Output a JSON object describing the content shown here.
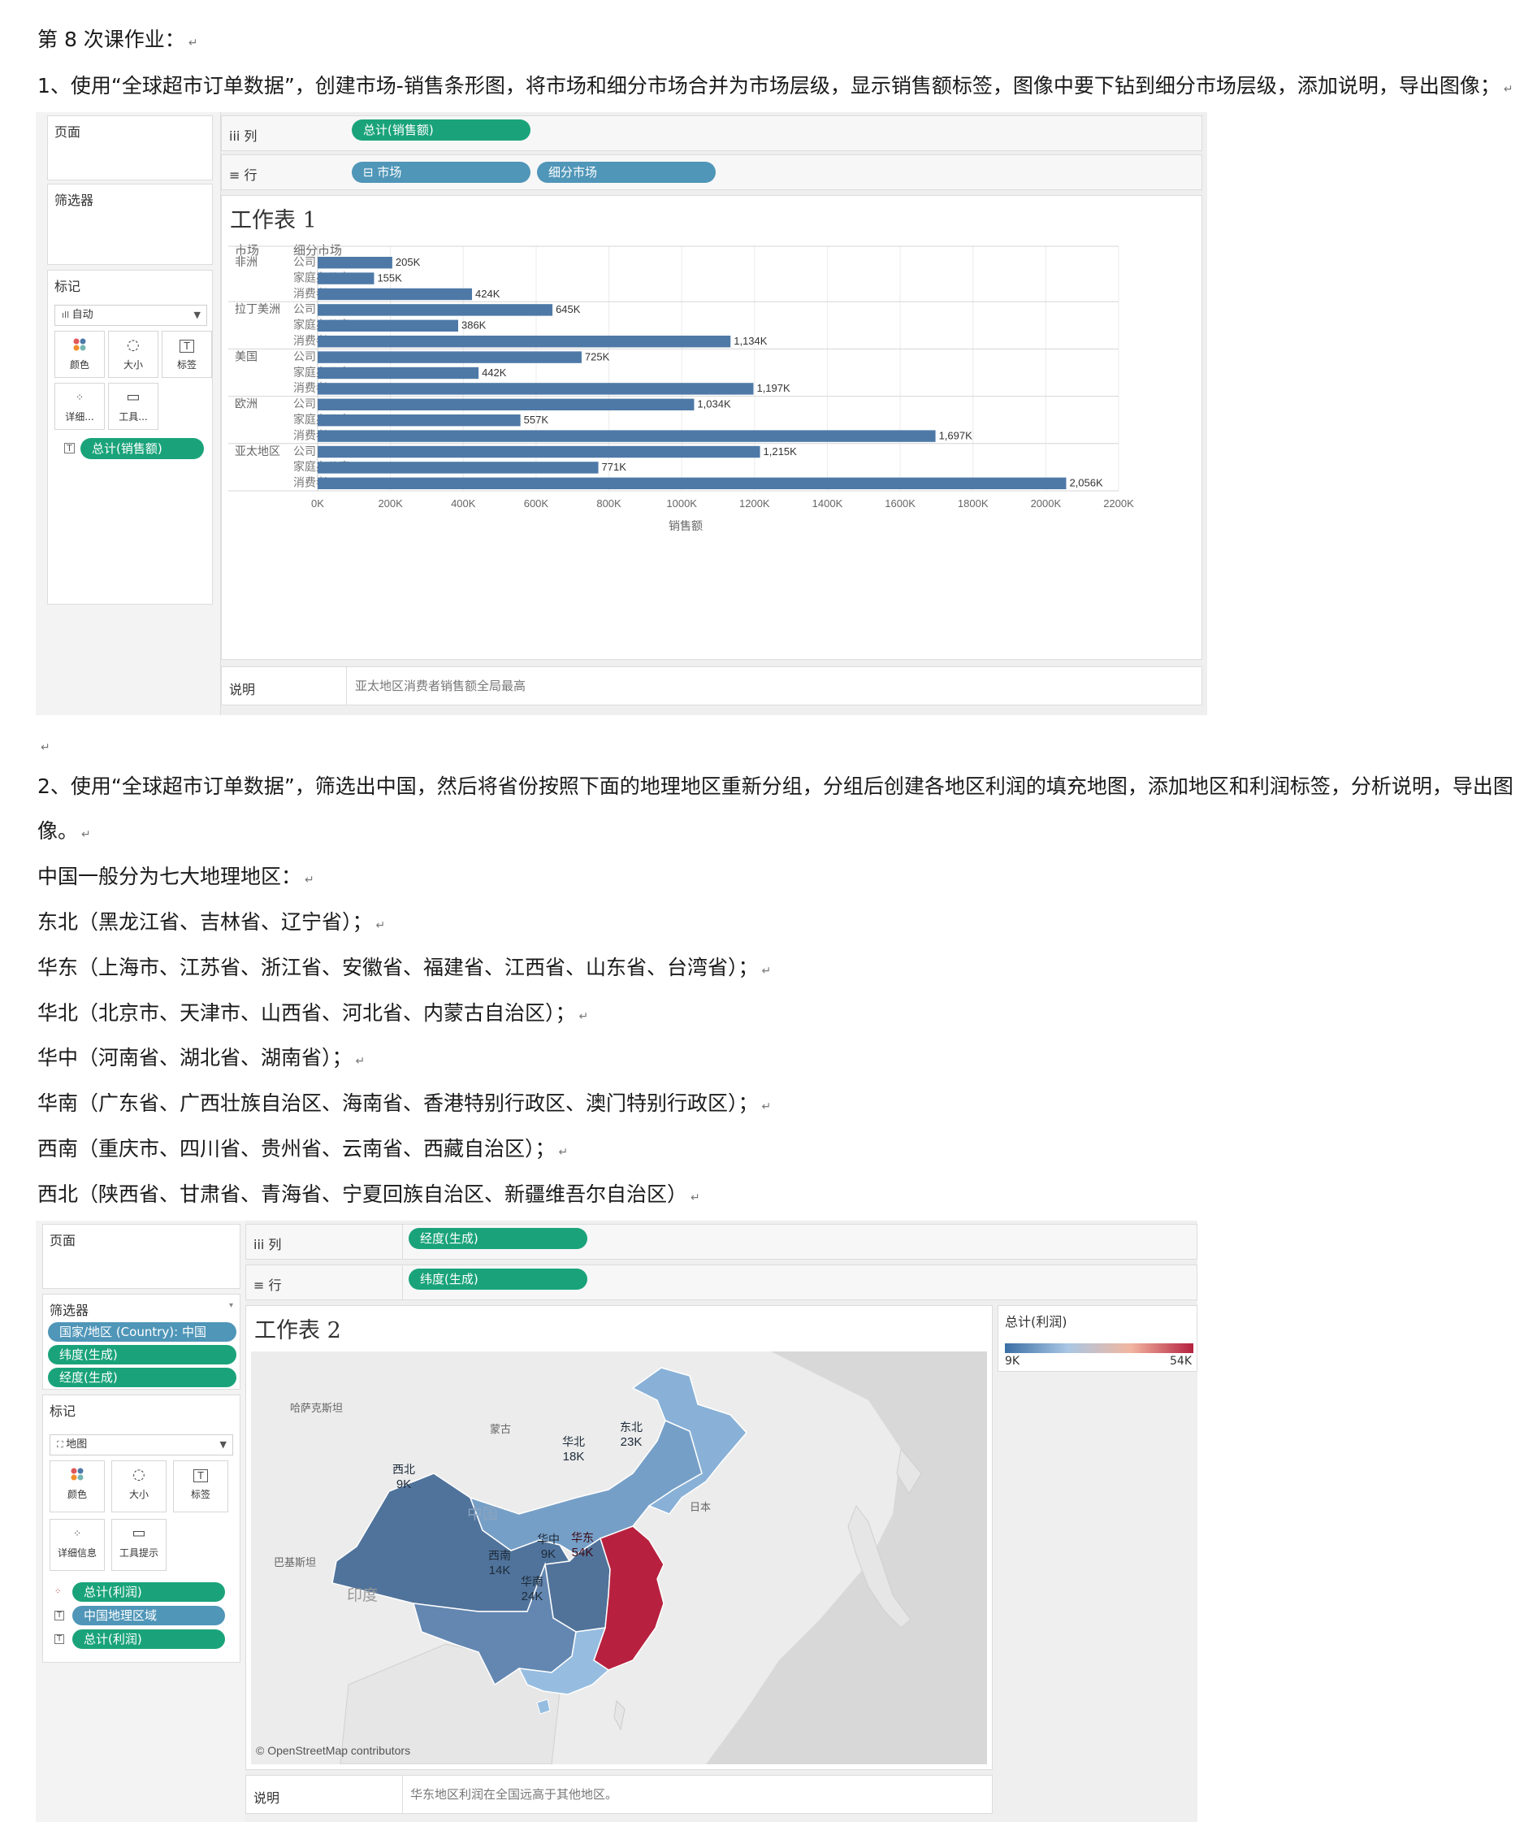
{
  "doc": {
    "heading": "第 8 次课作业：",
    "task1": "1、使用“全球超市订单数据”，创建市场-销售条形图，将市场和细分市场合并为市场层级，显示销售额标签，图像中要下钻到细分市场层级，添加说明，导出图像；",
    "task2_line1": "2、使用“全球超市订单数据”，筛选出中国，然后将省份按照下面的地理地区重新分组，分组后创建各地区利润的填充地图，添加地区和利润标签，分析说明，导出图",
    "task2_line2": "像。",
    "regions_intro": "中国一般分为七大地理地区：",
    "regions": [
      "东北（黑龙江省、吉林省、辽宁省）；",
      "华东（上海市、江苏省、浙江省、安徽省、福建省、江西省、山东省、台湾省）；",
      "华北（北京市、天津市、山西省、河北省、内蒙古自治区）；",
      "华中（河南省、湖北省、湖南省）；",
      "华南（广东省、广西壮族自治区、海南省、香港特别行政区、澳门特别行政区）；",
      "西南（重庆市、四川省、贵州省、云南省、西藏自治区）；",
      "西北（陕西省、甘肃省、青海省、宁夏回族自治区、新疆维吾尔自治区）"
    ]
  },
  "shot1": {
    "pages_label": "页面",
    "filters_label": "筛选器",
    "marks_label": "标记",
    "mark_type": "自动",
    "mark_buttons": [
      "颜色",
      "大小",
      "标签",
      "详细...",
      "工具..."
    ],
    "mark_pill": "总计(销售额)",
    "col_label": "iii 列",
    "row_label": "≡ 行",
    "col_pill": "总计(销售额)",
    "row_pills": [
      "⊟ 市场",
      "细分市场"
    ],
    "sheet_title": "工作表 1",
    "header_market": "市场",
    "header_segment": "细分市场",
    "caption_label": "说明",
    "caption_text": "亚太地区消费者销售额全局最高"
  },
  "chart_data": {
    "type": "bar",
    "orientation": "horizontal",
    "title": "工作表 1",
    "xlabel": "销售额",
    "xlim": [
      0,
      2200
    ],
    "x_ticks": [
      "0K",
      "200K",
      "400K",
      "600K",
      "800K",
      "1000K",
      "1200K",
      "1400K",
      "1600K",
      "1800K",
      "2000K",
      "2200K"
    ],
    "grid": true,
    "color": "#4e79a7",
    "groups": [
      {
        "market": "非洲",
        "rows": [
          {
            "segment": "公司",
            "value": 205,
            "label": "205K"
          },
          {
            "segment": "家庭办公室",
            "value": 155,
            "label": "155K"
          },
          {
            "segment": "消费者",
            "value": 424,
            "label": "424K"
          }
        ]
      },
      {
        "market": "拉丁美洲",
        "rows": [
          {
            "segment": "公司",
            "value": 645,
            "label": "645K"
          },
          {
            "segment": "家庭办公室",
            "value": 386,
            "label": "386K"
          },
          {
            "segment": "消费者",
            "value": 1134,
            "label": "1,134K"
          }
        ]
      },
      {
        "market": "美国",
        "rows": [
          {
            "segment": "公司",
            "value": 725,
            "label": "725K"
          },
          {
            "segment": "家庭办公室",
            "value": 442,
            "label": "442K"
          },
          {
            "segment": "消费者",
            "value": 1197,
            "label": "1,197K"
          }
        ]
      },
      {
        "market": "欧洲",
        "rows": [
          {
            "segment": "公司",
            "value": 1034,
            "label": "1,034K"
          },
          {
            "segment": "家庭办公室",
            "value": 557,
            "label": "557K"
          },
          {
            "segment": "消费者",
            "value": 1697,
            "label": "1,697K"
          }
        ]
      },
      {
        "market": "亚太地区",
        "rows": [
          {
            "segment": "公司",
            "value": 1215,
            "label": "1,215K"
          },
          {
            "segment": "家庭办公室",
            "value": 771,
            "label": "771K"
          },
          {
            "segment": "消费者",
            "value": 2056,
            "label": "2,056K"
          }
        ]
      }
    ]
  },
  "shot2": {
    "pages_label": "页面",
    "filters_label": "筛选器",
    "filter_pills": [
      "国家/地区 (Country): 中国",
      "纬度(生成)",
      "经度(生成)"
    ],
    "marks_label": "标记",
    "mark_type": "地图",
    "mark_buttons": [
      "颜色",
      "大小",
      "标签",
      "详细信息",
      "工具提示"
    ],
    "mark_pills": [
      "总计(利润)",
      "中国地理区域",
      "总计(利润)"
    ],
    "col_label": "iii 列",
    "row_label": "≡ 行",
    "col_pill": "经度(生成)",
    "row_pill": "纬度(生成)",
    "sheet_title": "工作表 2",
    "legend_title": "总计(利润)",
    "legend_min": "9K",
    "legend_max": "54K",
    "legend_colors": [
      "#3b6ea5",
      "#a9c7e4",
      "#f2b6a0",
      "#b5213f"
    ],
    "map_regions": [
      {
        "name": "西北",
        "value": "9K",
        "color": "#50739b"
      },
      {
        "name": "华北",
        "value": "18K",
        "color": "#769fc7"
      },
      {
        "name": "东北",
        "value": "23K",
        "color": "#89b1d7"
      },
      {
        "name": "华中",
        "value": "9K",
        "color": "#51739a"
      },
      {
        "name": "华东",
        "value": "54K",
        "color": "#b7213f"
      },
      {
        "name": "西南",
        "value": "14K",
        "color": "#6387b1"
      },
      {
        "name": "华南",
        "value": "24K",
        "color": "#96bde0"
      }
    ],
    "map_places": [
      "哈萨克斯坦",
      "蒙古",
      "中国",
      "日本",
      "巴基斯坦",
      "印度"
    ],
    "attribution": "© OpenStreetMap contributors",
    "caption_label": "说明",
    "caption_text": "华东地区利润在全国远高于其他地区。"
  }
}
